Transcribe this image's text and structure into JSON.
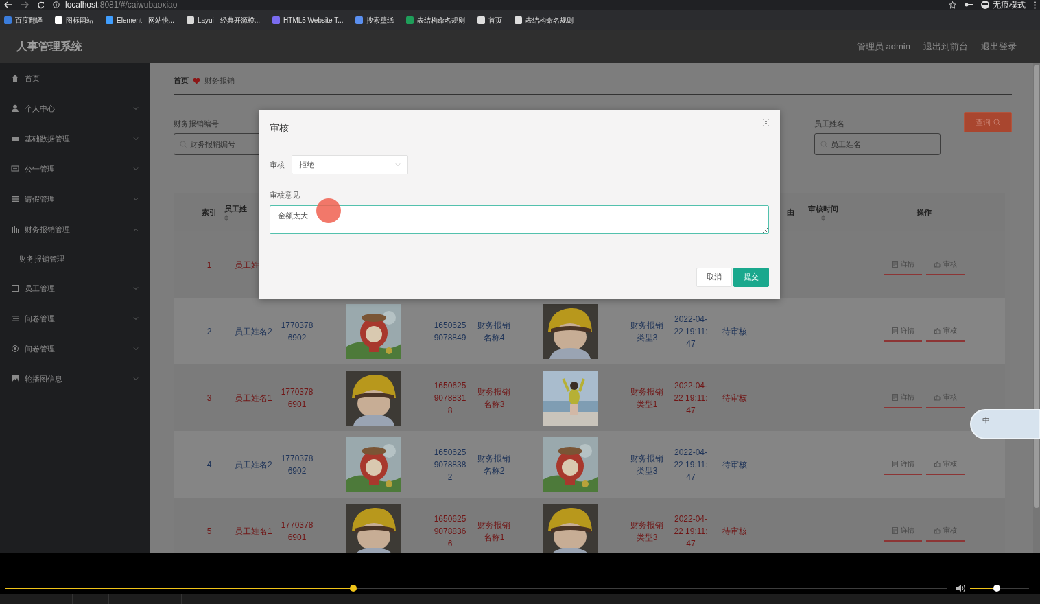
{
  "browser": {
    "url": "localhost:8081/#/caiwubaoxiao",
    "profile_label": "无痕模式",
    "bookmarks": [
      {
        "label": "百度翻译",
        "color": "#3b7ddd"
      },
      {
        "label": "图标网站",
        "color": "#ffffff"
      },
      {
        "label": "Element - 网站快...",
        "color": "#409eff"
      },
      {
        "label": "Layui - 经典开源模...",
        "color": "#d8d8d8"
      },
      {
        "label": "HTML5 Website T...",
        "color": "#7a6cf0"
      },
      {
        "label": "搜索壁纸",
        "color": "#5a8ff0"
      },
      {
        "label": "表结构命名规则",
        "color": "#1e9e5a"
      },
      {
        "label": "首页",
        "color": "#dddddd"
      },
      {
        "label": "表结构命名规则",
        "color": "#dddddd"
      }
    ]
  },
  "app": {
    "title": "人事管理系统",
    "user_links": [
      "管理员 admin",
      "退出到前台",
      "退出登录"
    ]
  },
  "sidebar": {
    "items": [
      {
        "label": "首页"
      },
      {
        "label": "个人中心",
        "expanded": false
      },
      {
        "label": "基础数据管理",
        "expanded": false
      },
      {
        "label": "公告管理",
        "expanded": false
      },
      {
        "label": "请假管理",
        "expanded": false
      },
      {
        "label": "财务报销管理",
        "expanded": true,
        "children": [
          {
            "label": "财务报销管理"
          }
        ]
      },
      {
        "label": "员工管理",
        "expanded": false
      },
      {
        "label": "问卷管理",
        "expanded": false
      },
      {
        "label": "问卷管理",
        "expanded": false
      },
      {
        "label": "轮播图信息",
        "expanded": false
      }
    ]
  },
  "breadcrumb": [
    "首页",
    "财务报销"
  ],
  "search": {
    "fields": [
      {
        "label": "财务报销编号",
        "placeholder": "财务报销编号"
      },
      {
        "label": "员工姓名",
        "placeholder": "员工姓名"
      }
    ],
    "button": "查询"
  },
  "table": {
    "columns": [
      {
        "label": "索引",
        "sortable": false
      },
      {
        "label": "员工姓",
        "sortable": true
      },
      {
        "label": "由",
        "sortable": false
      },
      {
        "label": "审核时间",
        "sortable": true
      },
      {
        "label": "操作",
        "sortable": false
      }
    ],
    "rows": [
      {
        "color": "#701616",
        "index": "1",
        "name": "员工姓",
        "actions": [
          "详情",
          "审核"
        ]
      },
      {
        "color": "#1e3358",
        "index": "2",
        "name": "员工姓名2",
        "phone": "17703786902",
        "number": "16506259078849",
        "title": "财务报销名称4",
        "type": "财务报销类型3",
        "date": "2022-04-22 19:11:47",
        "status": "待审核",
        "actions": [
          "详情",
          "审核"
        ]
      },
      {
        "color": "#701616",
        "index": "3",
        "name": "员工姓名1",
        "phone": "17703786901",
        "number": "165062590788318",
        "title": "财务报销名称3",
        "type": "财务报销类型1",
        "date": "2022-04-22 19:11:47",
        "status": "待审核",
        "actions": [
          "详情",
          "审核"
        ]
      },
      {
        "color": "#1e3358",
        "index": "4",
        "name": "员工姓名2",
        "phone": "17703786902",
        "number": "165062590788382",
        "title": "财务报销名称2",
        "type": "财务报销类型3",
        "date": "2022-04-22 19:11:47",
        "status": "待审核",
        "actions": [
          "详情",
          "审核"
        ]
      },
      {
        "color": "#701616",
        "index": "5",
        "name": "员工姓名1",
        "phone": "17703786901",
        "number": "165062590788366",
        "title": "财务报销名称1",
        "type": "财务报销类型3",
        "date": "2022-04-22 19:11:47",
        "status": "待审核",
        "actions": [
          "详情",
          "审核"
        ]
      }
    ]
  },
  "modal": {
    "title": "审核",
    "fields": [
      {
        "kind": "select",
        "label": "审核",
        "value": "拒绝"
      },
      {
        "kind": "textarea",
        "label": "审核意见",
        "value": "金额太大",
        "focused": true
      }
    ],
    "buttons": [
      {
        "label": "取消",
        "kind": "default"
      },
      {
        "label": "提交",
        "kind": "primary"
      }
    ]
  },
  "ime": {
    "label": "中"
  },
  "player": {
    "progress": {
      "level": 0.37
    },
    "volume": {
      "level": 0.45
    }
  }
}
